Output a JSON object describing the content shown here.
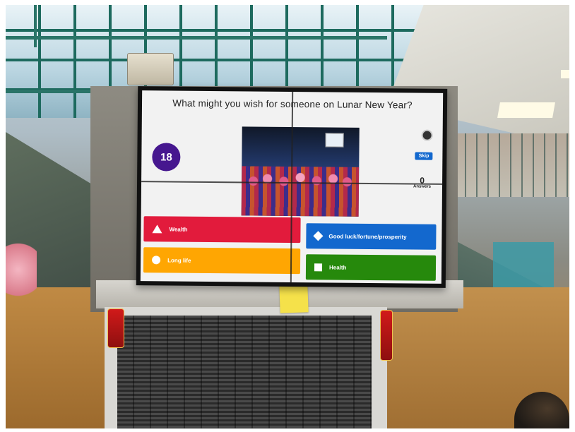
{
  "quiz": {
    "question": "What might you wish for someone on Lunar New Year?",
    "timer": "18",
    "skip_label": "Skip",
    "answers_count": "0",
    "answers_label": "Answers",
    "options": [
      {
        "label": "Wealth",
        "shape": "triangle-icon",
        "color": "#e21b3c"
      },
      {
        "label": "Good luck/fortune/prosperity",
        "shape": "diamond-icon",
        "color": "#1368ce"
      },
      {
        "label": "Long life",
        "shape": "circle-icon",
        "color": "#ffa602"
      },
      {
        "label": "Health",
        "shape": "square-icon",
        "color": "#26890c"
      }
    ],
    "accent_purple": "#46178f"
  }
}
